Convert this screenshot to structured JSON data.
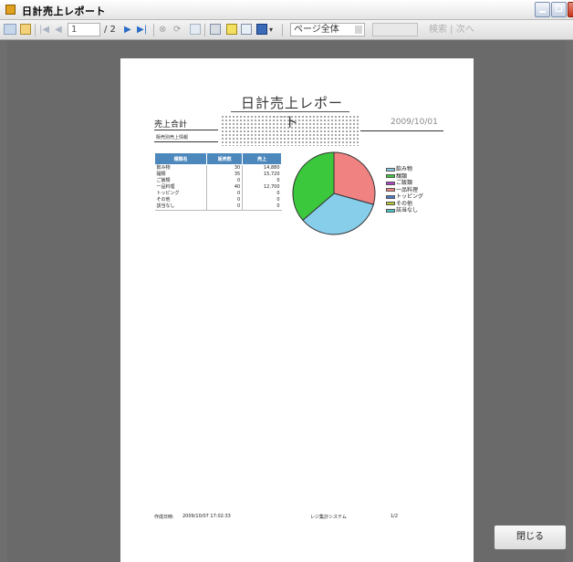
{
  "window": {
    "title": "日計売上レポート"
  },
  "toolbar": {
    "page_current": "1",
    "page_total": "/ 2",
    "zoom": "ページ全体",
    "search_button": "検索 | 次へ"
  },
  "report": {
    "title": "日計売上レポート",
    "sales_total_label": "売上合計",
    "sales_subtext": "販売別売上情報",
    "dot_caption": "\" \" ' \"\" \"\"",
    "date": "2009/10/01",
    "table": {
      "headers": [
        "種類名",
        "販売数",
        "売上"
      ],
      "rows": [
        [
          "飲み物",
          "30",
          "14,880"
        ],
        [
          "麺類",
          "35",
          "15,720"
        ],
        [
          "ご飯類",
          "0",
          "0"
        ],
        [
          "一品料理",
          "40",
          "12,700"
        ],
        [
          "トッピング",
          "0",
          "0"
        ],
        [
          "その他",
          "0",
          "0"
        ],
        [
          "該当なし",
          "0",
          "0"
        ]
      ]
    },
    "legend": [
      "飲み物",
      "麺類",
      "ご飯類",
      "一品料理",
      "トッピング",
      "その他",
      "該当なし"
    ],
    "colors": {
      "drink": "#87ceeb",
      "noodles": "#3cc83c",
      "rice": "#b044c8",
      "dish": "#f08282",
      "topping": "#4a7ac8",
      "other": "#b8c832",
      "none": "#4ac8c8"
    },
    "footer": {
      "created_label": "作成日時:",
      "created_value": "2009/10/07 17:02:33",
      "system": "レジ集計システム",
      "page": "1/2"
    }
  },
  "close_button": "閉じる",
  "chart_data": {
    "type": "pie",
    "categories": [
      "飲み物",
      "麺類",
      "ご飯類",
      "一品料理",
      "トッピング",
      "その他",
      "該当なし"
    ],
    "values": [
      14880,
      15720,
      0,
      12700,
      0,
      0,
      0
    ],
    "colors": [
      "#87ceeb",
      "#3cc83c",
      "#b044c8",
      "#f08282",
      "#4a7ac8",
      "#b8c832",
      "#4ac8c8"
    ],
    "legend": "right"
  }
}
